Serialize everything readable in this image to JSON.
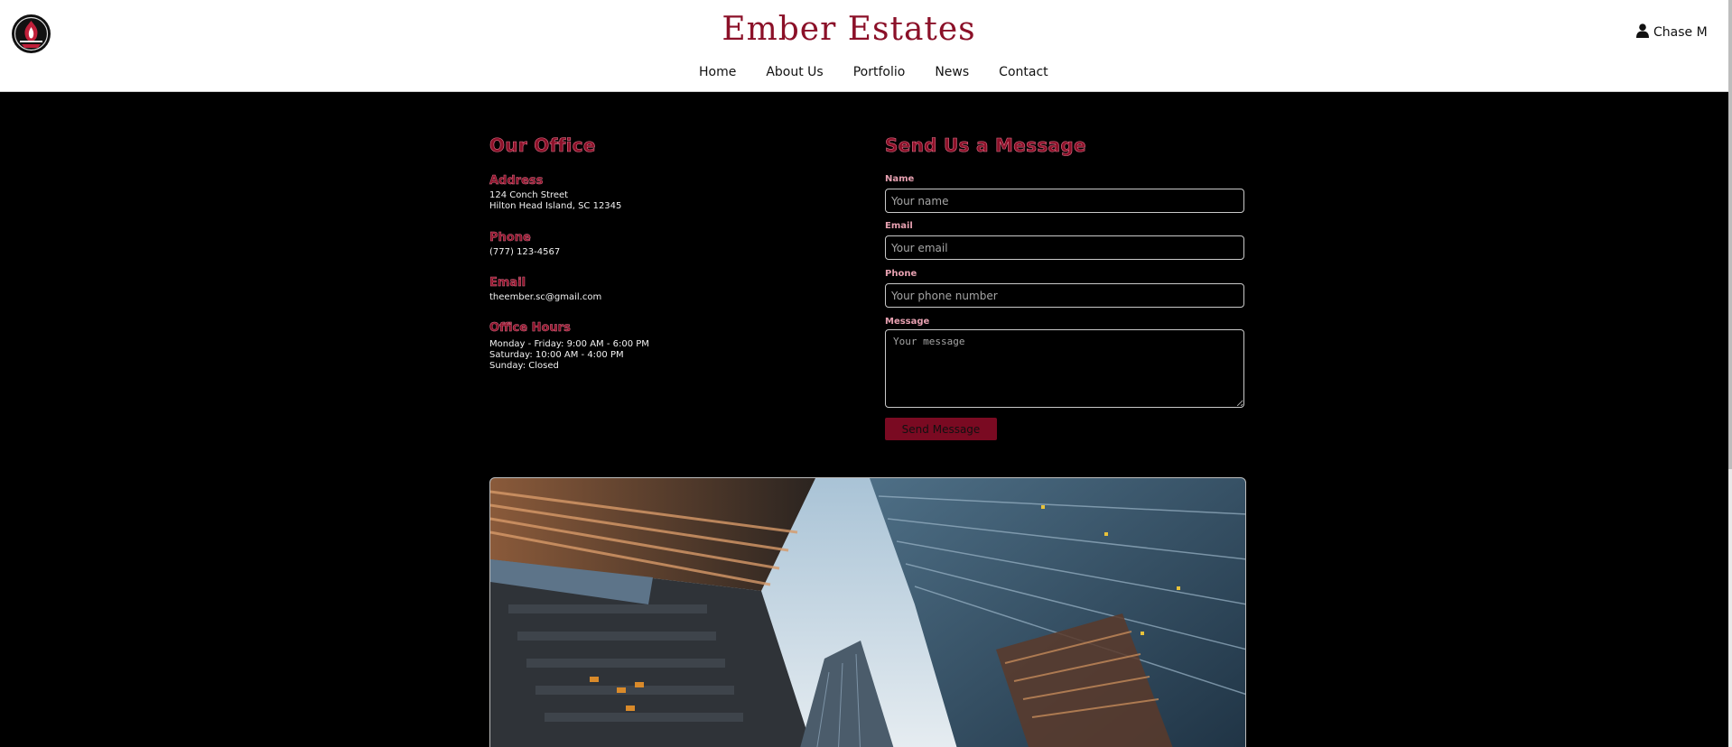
{
  "header": {
    "site_title": "Ember Estates",
    "user_name": "Chase M",
    "nav": [
      "Home",
      "About Us",
      "Portfolio",
      "News",
      "Contact"
    ]
  },
  "office": {
    "title": "Our Office",
    "address_label": "Address",
    "address_line1": "124 Conch Street",
    "address_line2": "Hilton Head Island, SC 12345",
    "phone_label": "Phone",
    "phone": "(777) 123-4567",
    "email_label": "Email",
    "email": "theember.sc@gmail.com",
    "hours_label": "Office Hours",
    "hours": [
      "Monday - Friday: 9:00 AM - 6:00 PM",
      "Saturday: 10:00 AM - 4:00 PM",
      "Sunday: Closed"
    ]
  },
  "form": {
    "title": "Send Us a Message",
    "name_label": "Name",
    "name_placeholder": "Your name",
    "email_label": "Email",
    "email_placeholder": "Your email",
    "phone_label": "Phone",
    "phone_placeholder": "Your phone number",
    "message_label": "Message",
    "message_placeholder": "Your message",
    "submit_label": "Send Message"
  },
  "colors": {
    "brand": "#8b1028",
    "heading_outline": "#e0708a",
    "page_background": "#000000",
    "header_background": "#ffffff"
  },
  "icons": {
    "logo": "ember-flame-logo",
    "user": "user-icon"
  }
}
